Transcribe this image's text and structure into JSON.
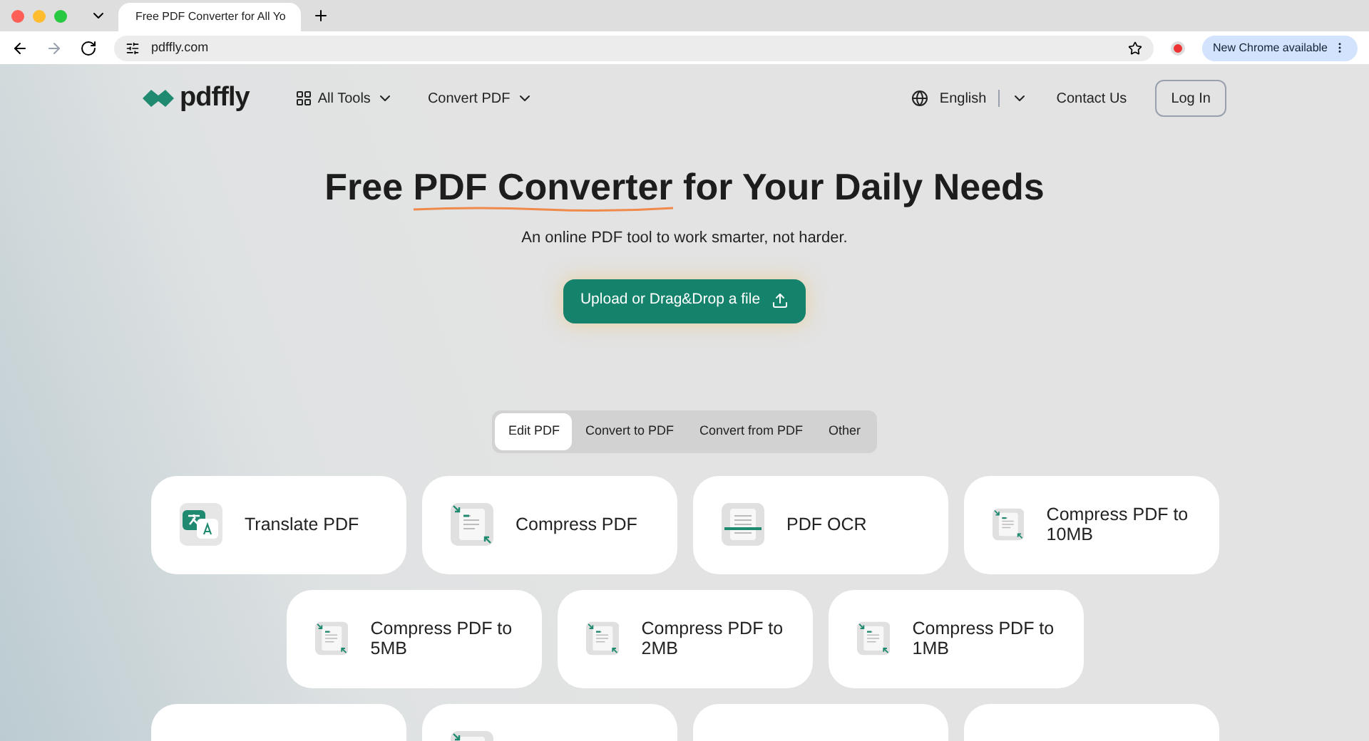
{
  "browser": {
    "tab_title": "Free PDF Converter for All Yo",
    "url": "pdffly.com",
    "update_button": "New Chrome available"
  },
  "nav": {
    "logo": "pdffly",
    "menus": [
      {
        "label": "All Tools",
        "kind": "grid"
      },
      {
        "label": "Convert PDF",
        "kind": "plain"
      }
    ],
    "language": "English",
    "contact": "Contact Us",
    "login": "Log In"
  },
  "hero": {
    "title_before": "Free ",
    "title_highlight": "PDF Converter",
    "title_after": " for Your Daily Needs",
    "subtitle": "An online PDF tool to work smarter, not harder.",
    "upload_button": "Upload or Drag&Drop a file"
  },
  "tabs": [
    {
      "label": "Edit PDF",
      "selected": true
    },
    {
      "label": "Convert to PDF",
      "selected": false
    },
    {
      "label": "Convert from PDF",
      "selected": false
    },
    {
      "label": "Other",
      "selected": false
    }
  ],
  "tool_rows": [
    [
      {
        "kind": "translate",
        "label": "Translate PDF"
      },
      {
        "kind": "compress",
        "label": "Compress PDF"
      },
      {
        "kind": "ocr",
        "label": "PDF OCR"
      },
      {
        "kind": "compress",
        "label": "Compress PDF to 10MB"
      }
    ],
    [
      {
        "kind": "compress",
        "label": "Compress PDF to 5MB"
      },
      {
        "kind": "compress",
        "label": "Compress PDF to 2MB"
      },
      {
        "kind": "compress",
        "label": "Compress PDF to 1MB"
      }
    ],
    [
      {
        "kind": "blank"
      },
      {
        "kind": "compress"
      },
      {
        "kind": "blank"
      },
      {
        "kind": "blank"
      }
    ]
  ]
}
